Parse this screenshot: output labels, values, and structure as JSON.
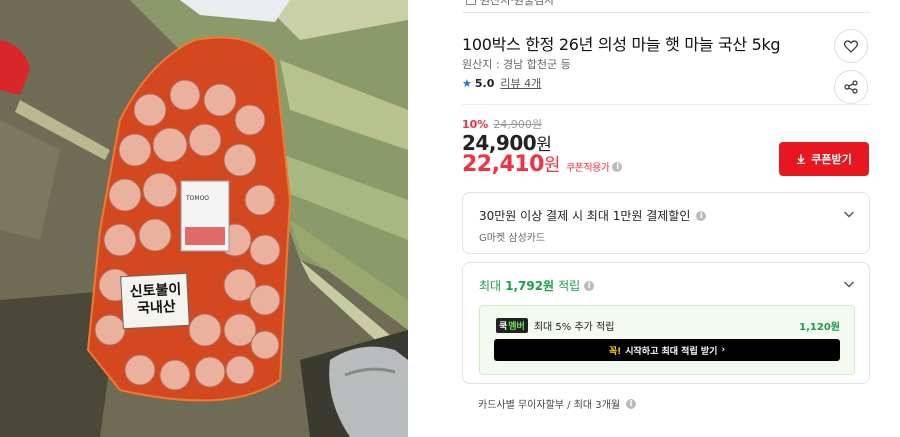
{
  "photo": {
    "bag_label_line1": "신토불이",
    "bag_label_line2": "국내산",
    "tag_text": "TOMOO"
  },
  "header": {
    "origin_link_text": "원산지·원물검사"
  },
  "product": {
    "title": "100박스 한정 26년 의성 마늘 햇 마늘 국산 5kg",
    "origin": "원산지 : 경남 합천군 등",
    "rating_score": "5.0",
    "rating_reviews": "리뷰 4개"
  },
  "pricing": {
    "discount_rate": "10%",
    "original_price": "24,900원",
    "sale_price": "24,900",
    "sale_price_unit": "원",
    "coupon_price": "22,410",
    "coupon_price_unit": "원",
    "coupon_tag": "쿠폰적용가",
    "coupon_button": "쿠폰받기"
  },
  "card_discount": {
    "title": "30만원 이상 결제 시 최대 1만원 결제할인",
    "subtitle": "G마켓 삼성카드"
  },
  "points": {
    "title_prefix": "최대",
    "amount": "1,792원",
    "title_suffix": "적립",
    "badge_a": "쿡",
    "badge_b": "멤버",
    "extra_label": "최대 5% 추가 적립",
    "extra_points": "1,120원",
    "join_button_highlight": "꼭!",
    "join_button_text": "시작하고 최대 적립 받기"
  },
  "installment": {
    "text": "카드사별 무이자할부 / 최대 3개월"
  },
  "colors": {
    "accent_red": "#e6171f",
    "price_red": "#f43142",
    "points_green": "#1a9e4b",
    "star_blue": "#1c6fe0"
  }
}
